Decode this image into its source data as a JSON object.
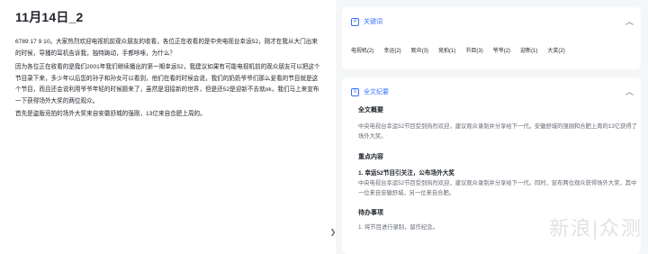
{
  "document": {
    "title": "11月14日_2",
    "paragraphs": [
      "6789 17 9 10。大家热烈欢迎电视机前观众朋友的收看，各位正在收看的是中央电视台幸运52，刚才在我从大门出来的时候，导播的耳机告诉我，独特踌动，手都哆嗦，为什么？",
      "因为各位正在收看的是我们2001年我们继续播出的第一期幸运52，我建议如果有可能电视机前的观众朋友可以把这个节目录下来，多少年以后您的孙子和孙女可以看到，他们在看的时候会说，我们的奶奶爷爷们那么爱看的节目就是这个节目，而且还会说利用爷爷年轻的时候题来了，虽然是泪接新的世界，但是还52是迎新不去就ok，我们马上来宣布一下获得场外大奖的两位观众。",
      "首先是盗版竞拍的场外大奖来自安徽舒城的强刚，13亿来自合肥上周的。"
    ]
  },
  "keywords_panel": {
    "heading": "关键词",
    "icon": "tag-icon",
    "items": [
      "电视机(2)",
      "幸运(2)",
      "观众(3)",
      "竞拍(1)",
      "节目(3)",
      "爷爷(2)",
      "迎新(1)",
      "大奖(2)"
    ]
  },
  "summary_panel": {
    "heading": "全文纪要",
    "icon": "document-icon",
    "overview_title": "全文概要",
    "overview_text": "中央电视台幸运52节目受到热烈欢迎，建议观众录制并分享给下一代。安徽舒城的强刚和合肥上周的13亿获得了场外大奖。",
    "key_title": "重点内容",
    "point_title": "1. 幸运52节目引关注，公布场外大奖",
    "point_text": "中央电视台幸运52节目受到热烈欢迎，建议观众录制并分享给下一代。同时，宣布两位观众获得场外大奖，其中一位来自安徽舒城，另一位来自合肥。",
    "todo_title": "待办事项",
    "todo_text": "1. 将节目进行录制，留作纪念。"
  },
  "watermark": "新浪|众测"
}
